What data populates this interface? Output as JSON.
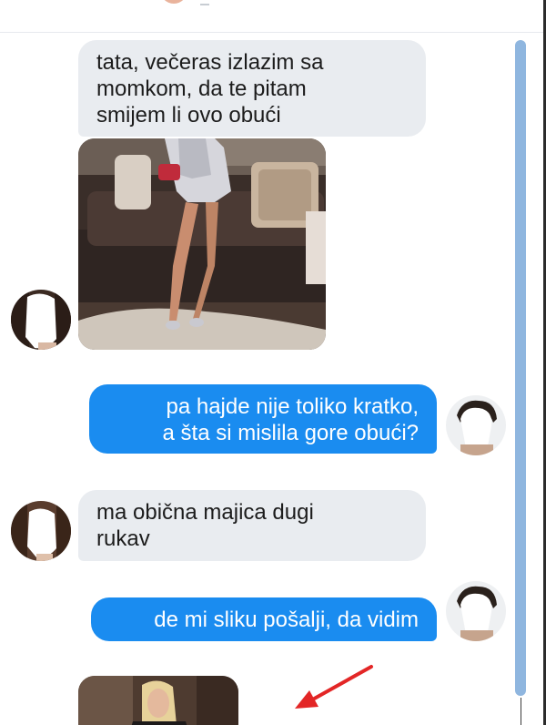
{
  "messages": [
    {
      "side": "in",
      "lines": [
        "tata, večeras izlazim sa",
        "momkom, da te pitam",
        "smijem li ovo obući"
      ]
    },
    {
      "side": "in",
      "type": "photo",
      "description_icon": "outfit-photo"
    },
    {
      "side": "out",
      "lines": [
        "pa hajde nije toliko kratko,",
        "a šta si mislila gore obući?"
      ]
    },
    {
      "side": "in",
      "lines": [
        "ma obična majica dugi",
        "rukav"
      ]
    },
    {
      "side": "out",
      "lines": [
        "de mi sliku pošalji, da vidim"
      ]
    },
    {
      "side": "in",
      "type": "photo",
      "description_icon": "shirt-photo"
    }
  ],
  "colors": {
    "incoming_bubble": "#e9ecf0",
    "outgoing_bubble": "#1a8cf0",
    "scrollbar": "#8fb6df",
    "arrow": "#e32626"
  },
  "icons": [
    "sender-avatar",
    "receiver-avatar",
    "red-arrow-icon"
  ]
}
